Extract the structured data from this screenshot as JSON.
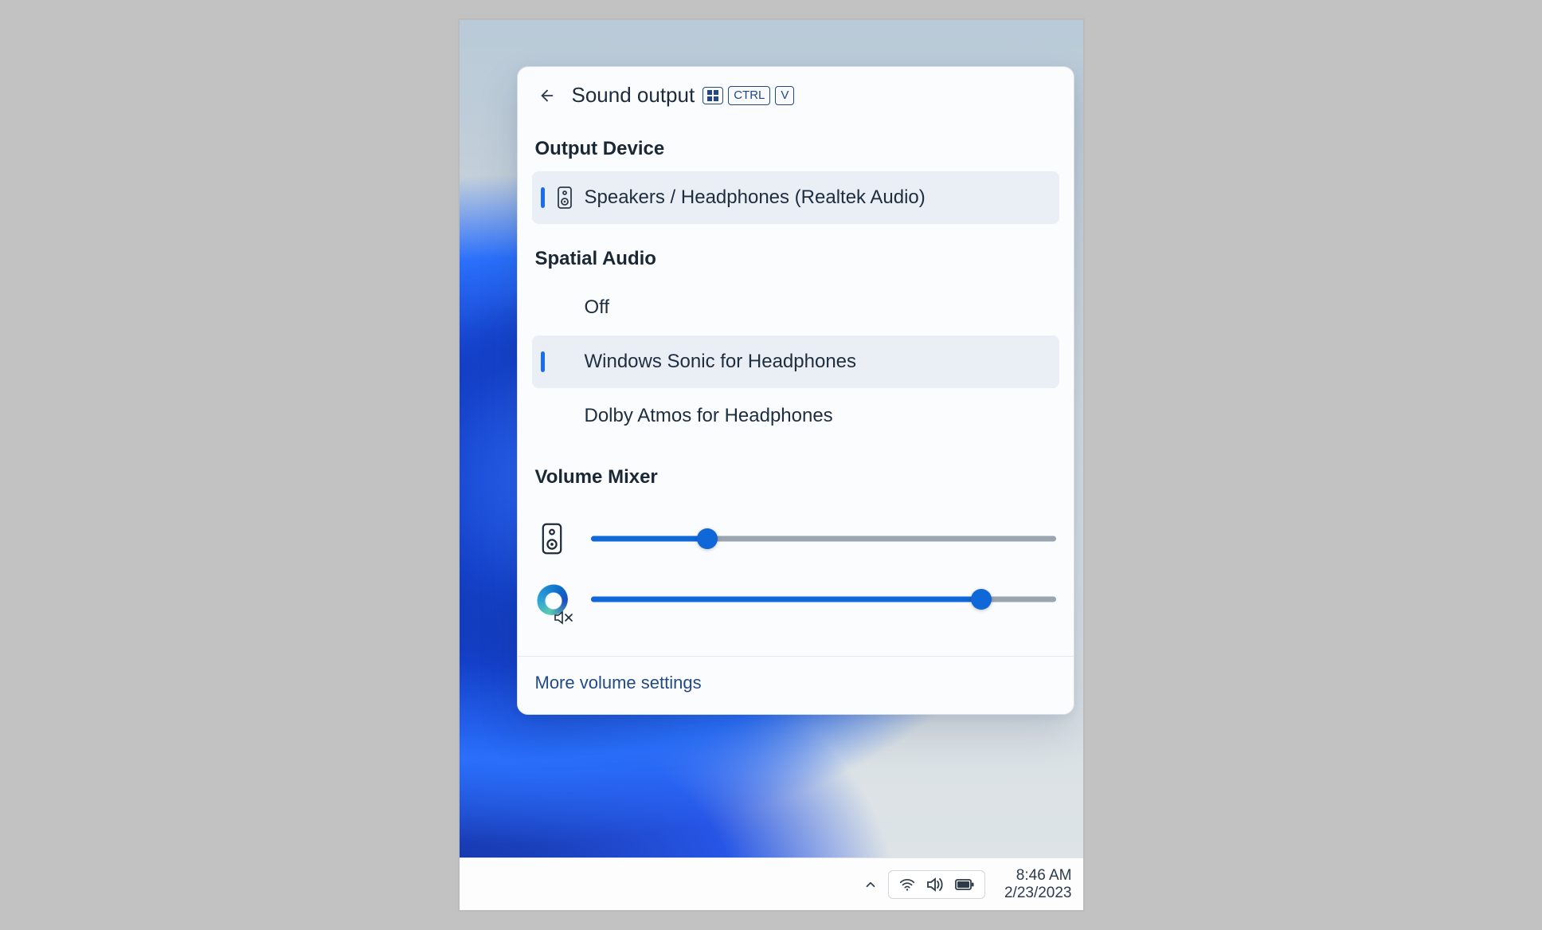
{
  "flyout": {
    "title": "Sound output",
    "shortcut_keys": [
      "CTRL",
      "V"
    ],
    "sections": {
      "output_device": {
        "heading": "Output Device",
        "items": [
          {
            "label": "Speakers / Headphones (Realtek Audio)",
            "selected": true,
            "icon": "speaker-device-icon"
          }
        ]
      },
      "spatial_audio": {
        "heading": "Spatial Audio",
        "items": [
          {
            "label": "Off",
            "selected": false
          },
          {
            "label": "Windows Sonic for Headphones",
            "selected": true
          },
          {
            "label": "Dolby Atmos for Headphones",
            "selected": false
          }
        ]
      },
      "volume_mixer": {
        "heading": "Volume Mixer",
        "rows": [
          {
            "app": "System speakers",
            "icon": "speaker-device-icon",
            "value_percent": 25,
            "muted": false
          },
          {
            "app": "Microsoft Edge",
            "icon": "edge-icon",
            "value_percent": 84,
            "muted": true
          }
        ]
      }
    },
    "footer_link": "More volume settings"
  },
  "taskbar": {
    "time": "8:46 AM",
    "date": "2/23/2023",
    "tray_icons": [
      "wifi-icon",
      "volume-icon",
      "battery-icon"
    ]
  },
  "colors": {
    "accent": "#1a6cf0",
    "slider_fill": "#1168d9",
    "text_primary": "#1a2735"
  }
}
